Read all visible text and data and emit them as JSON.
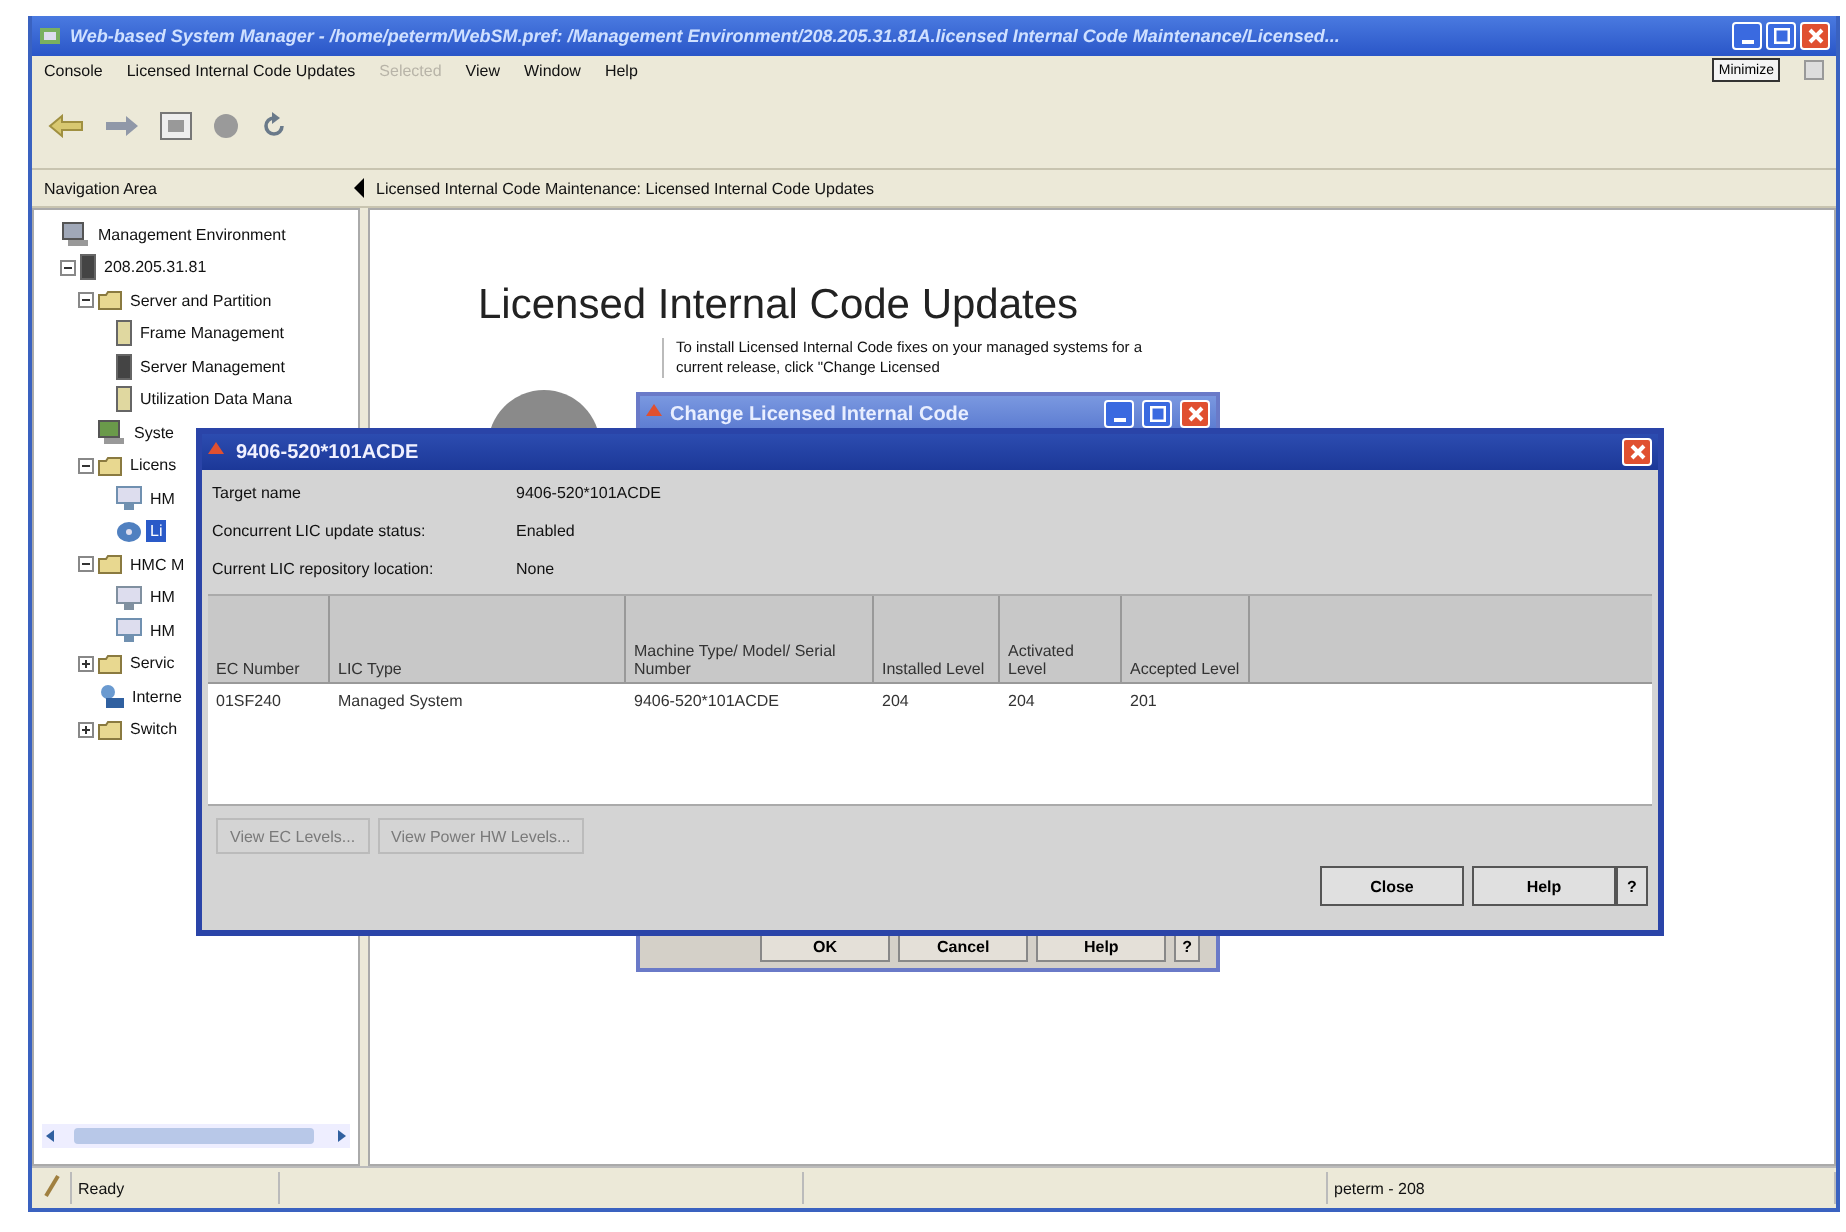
{
  "window": {
    "title": "Web-based System Manager - /home/peterm/WebSM.pref: /Management Environment/208.205.31.81A.licensed Internal Code Maintenance/Licensed..."
  },
  "menu": [
    {
      "label": "Console",
      "disabled": false
    },
    {
      "label": "Licensed Internal Code Updates",
      "disabled": false
    },
    {
      "label": "Selected",
      "disabled": true
    },
    {
      "label": "View",
      "disabled": false
    },
    {
      "label": "Window",
      "disabled": false
    },
    {
      "label": "Help",
      "disabled": false
    }
  ],
  "minimize_button": "Minimize",
  "navigation": {
    "header": "Navigation Area",
    "tree": [
      {
        "label": "Management Environment",
        "kind": "environment",
        "selected": false,
        "children": [
          {
            "label": "208.205.31.81",
            "kind": "server",
            "expanded": true,
            "selected": false,
            "children": [
              {
                "label": "Server and Partition",
                "kind": "folder",
                "expanded": true,
                "selected": false,
                "children": [
                  {
                    "label": "Frame Management",
                    "kind": "frame",
                    "selected": false
                  },
                  {
                    "label": "Server Management",
                    "kind": "server",
                    "selected": false
                  },
                  {
                    "label": "Utilization Data Mana",
                    "kind": "frame",
                    "selected": false
                  }
                ]
              },
              {
                "label": "Syste",
                "kind": "system",
                "selected": false
              },
              {
                "label": "Licens",
                "kind": "folder",
                "expanded": true,
                "selected": false,
                "children": [
                  {
                    "label": "HM",
                    "kind": "hmc",
                    "selected": false
                  },
                  {
                    "label": "Li",
                    "kind": "disk",
                    "selected": true
                  }
                ]
              },
              {
                "label": "HMC M",
                "kind": "folder",
                "expanded": true,
                "selected": false,
                "children": [
                  {
                    "label": "HM",
                    "kind": "monitor",
                    "selected": false
                  },
                  {
                    "label": "HM",
                    "kind": "hmc",
                    "selected": false
                  }
                ]
              },
              {
                "label": "Servic",
                "kind": "folder",
                "expanded": false,
                "selected": false
              },
              {
                "label": "Interne",
                "kind": "network",
                "selected": false
              },
              {
                "label": "Switch",
                "kind": "folder",
                "expanded": false,
                "selected": false
              }
            ]
          }
        ]
      }
    ]
  },
  "content": {
    "breadcrumb": "Licensed Internal Code Maintenance: Licensed Internal Code Updates",
    "heading": "Licensed Internal Code Updates",
    "text": "To install Licensed Internal Code fixes on your managed systems for a current release, click \"Change Licensed"
  },
  "back_dialog": {
    "title": "Change Licensed Internal Code",
    "buttons": [
      "OK",
      "Cancel",
      "Help",
      "?"
    ]
  },
  "dialog": {
    "title": "9406-520*101ACDE",
    "fields": [
      {
        "label": "Target name",
        "value": "9406-520*101ACDE"
      },
      {
        "label": "Concurrent LIC update status:",
        "value": "Enabled"
      },
      {
        "label": "Current LIC repository location:",
        "value": "None"
      }
    ],
    "table": {
      "columns": [
        "EC Number",
        "LIC Type",
        "Machine Type/ Model/ Serial Number",
        "Installed Level",
        "Activated Level",
        "Accepted Level"
      ],
      "rows": [
        [
          "01SF240",
          "Managed System",
          "9406-520*101ACDE",
          "204",
          "204",
          "201"
        ]
      ]
    },
    "level_buttons": [
      {
        "label": "View EC Levels...",
        "disabled": true
      },
      {
        "label": "View Power HW Levels...",
        "disabled": true
      }
    ],
    "buttons": [
      "Close",
      "Help",
      "?"
    ]
  },
  "status_bar": {
    "message": "Ready",
    "user": "peterm - 208"
  }
}
